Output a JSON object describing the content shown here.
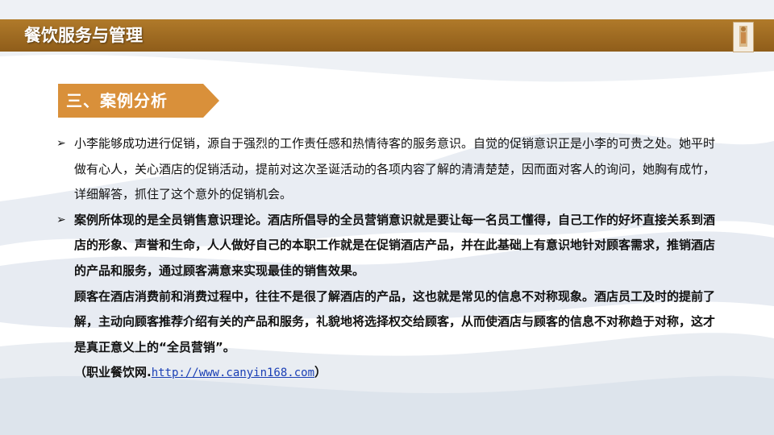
{
  "header": {
    "title": "餐饮服务与管理"
  },
  "section": {
    "title": "三、案例分析"
  },
  "paragraphs": [
    {
      "bullet": "➢",
      "text": "小李能够成功进行促销，源自于强烈的工作责任感和热情待客的服务意识。自觉的促销意识正是小李的可贵之处。她平时做有心人，关心酒店的促销活动，提前对这次圣诞活动的各项内容了解的清清楚楚，因而面对客人的询问，她胸有成竹，详细解答，抓住了这个意外的促销机会。"
    },
    {
      "bullet": "➢",
      "text": "案例所体现的是全员销售意识理论。酒店所倡导的全员营销意识就是要让每一名员工懂得，自己工作的好坏直接关系到酒店的形象、声誉和生命，人人做好自己的本职工作就是在促销酒店产品，并在此基础上有意识地针对顾客需求，推销酒店的产品和服务，通过顾客满意来实现最佳的销售效果。"
    },
    {
      "text": "顾客在酒店消费前和消费过程中，往往不是很了解酒店的产品，这也就是常见的信息不对称现象。酒店员工及时的提前了解，主动向顾客推荐介绍有关的产品和服务，礼貌地将选择权交给顾客，从而使酒店与顾客的信息不对称趋于对称，这才是真正意义上的“全员营销”。"
    }
  ],
  "source": {
    "prefix": "（职业餐饮网.",
    "link": "http://www.canyin168.com",
    "suffix": "）"
  },
  "colors": {
    "header_bar": "#9a661f",
    "section_tab": "#d9903a",
    "link": "#1a3fb5"
  }
}
